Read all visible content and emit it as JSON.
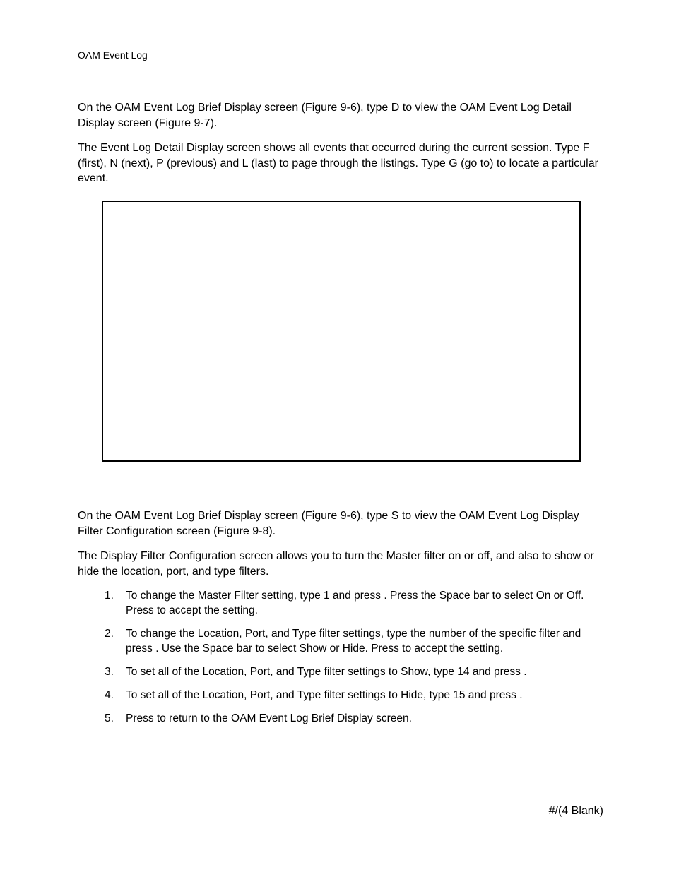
{
  "header": {
    "running": "OAM Event Log"
  },
  "body": {
    "p1": "On the OAM Event Log Brief Display screen (Figure 9-6), type D to view the OAM Event Log Detail Display screen (Figure 9-7).",
    "p2": "The Event Log Detail Display screen shows all events that occurred during the current session. Type F (first), N (next), P (previous) and L (last) to page through the listings. Type G (go to) to locate a particular event.",
    "p3": "On the OAM Event Log Brief Display screen (Figure 9-6), type S to view the OAM Event Log Display Filter Configuration screen (Figure 9-8).",
    "p4": "The Display Filter Configuration screen allows you to turn the Master filter on or off, and also to show or hide the location, port, and type filters."
  },
  "steps": {
    "s1a": "To change the Master Filter setting, type 1 and press ",
    "s1b": ". Press the Space bar to select On or Off. Press ",
    "s1c": " to accept the setting.",
    "s2a": "To change the Location, Port, and Type filter settings, type the number of the specific filter and press ",
    "s2b": ". Use the Space bar to select Show or Hide. Press ",
    "s2c": " to accept the setting.",
    "s3a": "To set all of the Location, Port, and Type filter settings to Show, type 14 and press ",
    "s3b": ".",
    "s4a": "To set all of the Location, Port, and Type filter settings to Hide, type 15 and press ",
    "s4b": ".",
    "s5a": "Press ",
    "s5b": " to return to the OAM Event Log Brief Display screen."
  },
  "keys": {
    "blank": "        "
  },
  "footer": {
    "pager": "#/(4 Blank)"
  }
}
